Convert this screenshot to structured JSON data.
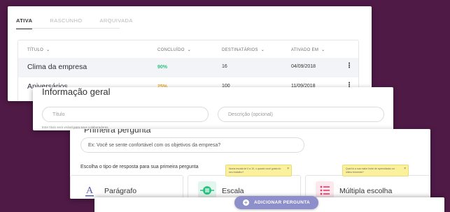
{
  "tabs": [
    {
      "label": "ATIVA",
      "active": true
    },
    {
      "label": "RASCUNHO",
      "active": false
    },
    {
      "label": "ARQUIVADA",
      "active": false
    }
  ],
  "table": {
    "headers": {
      "title": "TÍTULO",
      "completed": "CONCLUÍDO",
      "recipients": "DESTINATÁRIOS",
      "activated": "ATIVADO EM"
    },
    "rows": [
      {
        "name": "Clima da empresa",
        "completed": "90%",
        "recipients": "16",
        "activated": "04/09/2018",
        "menu": "⋮"
      },
      {
        "name": "Aniversários",
        "completed": "25%",
        "recipients": "100",
        "activated": "11/09/2018",
        "menu": "⋮"
      }
    ]
  },
  "general_info": {
    "title": "Informação geral",
    "title_placeholder": "Título",
    "description_placeholder": "Descrição (opcional)",
    "note": "Este título será visível para seus colaboradores"
  },
  "first_question": {
    "title": "Primeira pergunta",
    "question_value": "Ex: Você se sente confortável com os objetivos da empresa?",
    "prompt": "Escolha o tipo de resposta para sua primeira pergunta",
    "options": [
      {
        "label": "Parágrafo",
        "icon": "text-icon"
      },
      {
        "label": "Escala",
        "icon": "scale-icon"
      },
      {
        "label": "Múltipla escolha",
        "icon": "list-icon"
      }
    ],
    "tooltips": [
      {
        "text": "Numa escala de 0 a 10, o quanto você gosta do seu trabalho?",
        "close": "×"
      },
      {
        "text": "Qual foi a sua maior fonte de aprendizado no último trimestre?",
        "close": "×"
      }
    ]
  },
  "add_question_label": "ADICIONAR PERGUNTA",
  "colors": {
    "background": "#4f1a46",
    "accent": "#8c8fc9",
    "green": "#27c281",
    "orange": "#f0a21b",
    "tooltip": "#fbf19c"
  }
}
